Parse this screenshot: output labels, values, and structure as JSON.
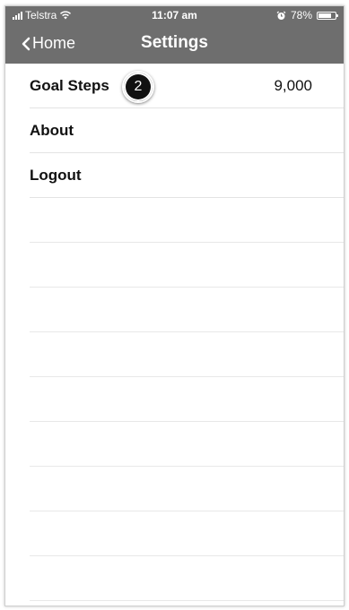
{
  "status_bar": {
    "carrier": "Telstra",
    "time": "11:07 am",
    "battery_percent": "78%",
    "battery_level": 0.78
  },
  "nav": {
    "back_label": "Home",
    "title": "Settings"
  },
  "settings": {
    "items": [
      {
        "label": "Goal Steps",
        "value": "9,000",
        "badge": "2"
      },
      {
        "label": "About"
      },
      {
        "label": "Logout"
      }
    ]
  },
  "icons": {
    "back": "chevron-left-icon",
    "signal": "signal-icon",
    "wifi": "wifi-icon",
    "alarm": "alarm-icon",
    "battery": "battery-icon"
  },
  "colors": {
    "nav_background": "#6e6e6e",
    "text": "#111111",
    "divider": "#e3e3e3",
    "badge": "#111111"
  }
}
